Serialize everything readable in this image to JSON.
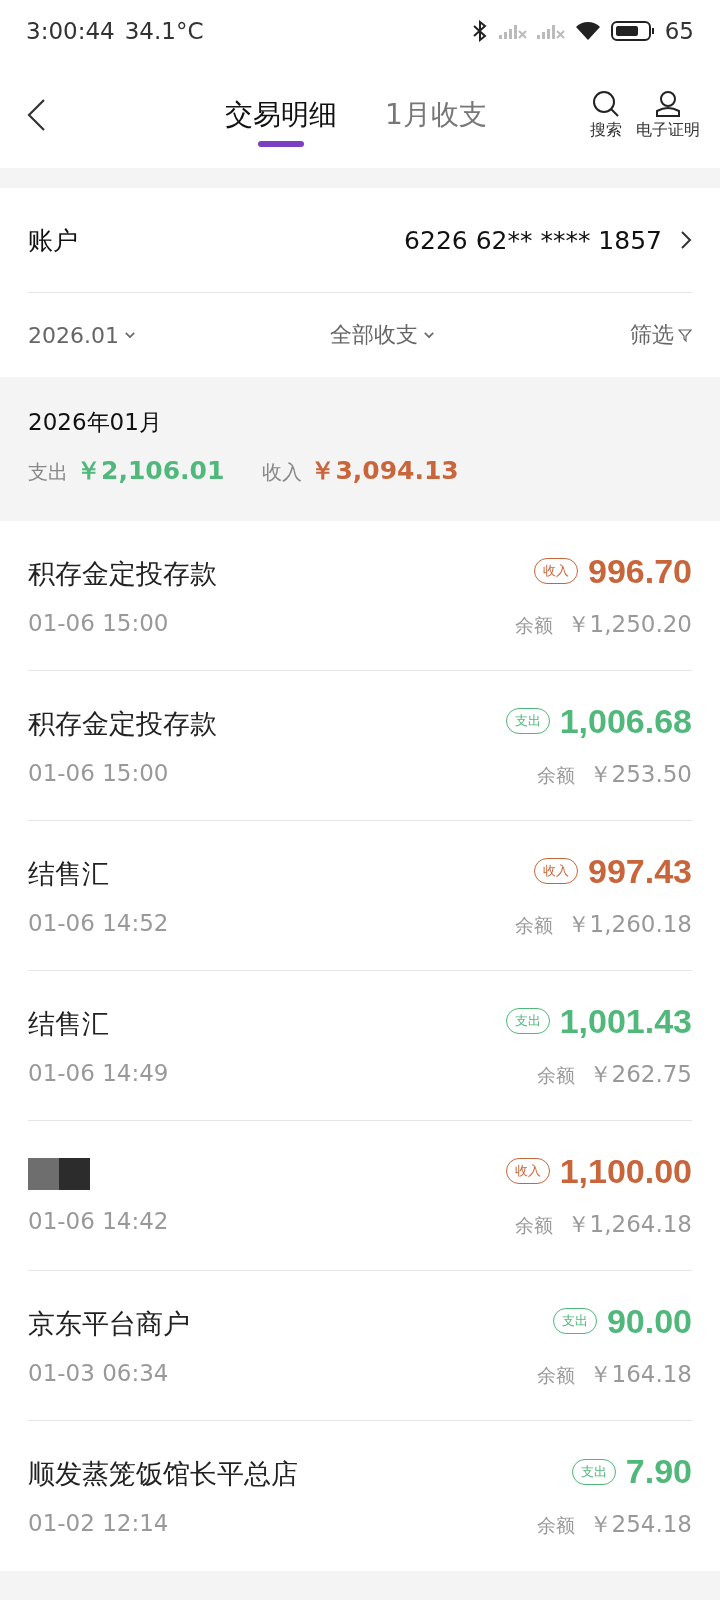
{
  "status_bar": {
    "time": "3:00:44",
    "temperature": "34.1°C",
    "battery_percent": "65"
  },
  "header": {
    "tabs": [
      {
        "label": "交易明细",
        "selected": true
      },
      {
        "label": "1月收支",
        "selected": false
      }
    ],
    "actions": [
      {
        "kind": "search",
        "label": "搜索"
      },
      {
        "kind": "certificate",
        "label": "电子证明"
      }
    ]
  },
  "account": {
    "label": "账户",
    "number": "6226 62** **** 1857"
  },
  "filters": {
    "month": "2026.01",
    "type": "全部收支",
    "filter": "筛选"
  },
  "summary": {
    "title": "2026年01月",
    "expense_label": "支出",
    "expense": "￥2,106.01",
    "income_label": "收入",
    "income": "￥3,094.13"
  },
  "transactions": [
    {
      "kind": "named",
      "name": "积存金定投存款",
      "time": "01-06 15:00",
      "color": "#c8653a",
      "badge": "收入",
      "amount": "996.70",
      "balance_label": "余额",
      "balance": "￥1,250.20"
    },
    {
      "kind": "named",
      "name": "积存金定投存款",
      "time": "01-06 15:00",
      "color": "#4fb87a",
      "badge": "支出",
      "amount": "1,006.68",
      "balance_label": "余额",
      "balance": "￥253.50"
    },
    {
      "kind": "named",
      "name": "结售汇",
      "time": "01-06 14:52",
      "color": "#c8653a",
      "badge": "收入",
      "amount": "997.43",
      "balance_label": "余额",
      "balance": "￥1,260.18"
    },
    {
      "kind": "named",
      "name": "结售汇",
      "time": "01-06 14:49",
      "color": "#4fb87a",
      "badge": "支出",
      "amount": "1,001.43",
      "balance_label": "余额",
      "balance": "￥262.75"
    },
    {
      "kind": "redacted",
      "time": "01-06 14:42",
      "color": "#c8653a",
      "badge": "收入",
      "amount": "1,100.00",
      "balance_label": "余额",
      "balance": "￥1,264.18"
    },
    {
      "kind": "named",
      "name": "京东平台商户",
      "time": "01-03 06:34",
      "color": "#4fb87a",
      "badge": "支出",
      "amount": "90.00",
      "balance_label": "余额",
      "balance": "￥164.18"
    },
    {
      "kind": "named",
      "name": "顺发蒸笼饭馆长平总店",
      "time": "01-02 12:14",
      "color": "#4fb87a",
      "badge": "支出",
      "amount": "7.90",
      "balance_label": "余额",
      "balance": "￥254.18"
    }
  ]
}
